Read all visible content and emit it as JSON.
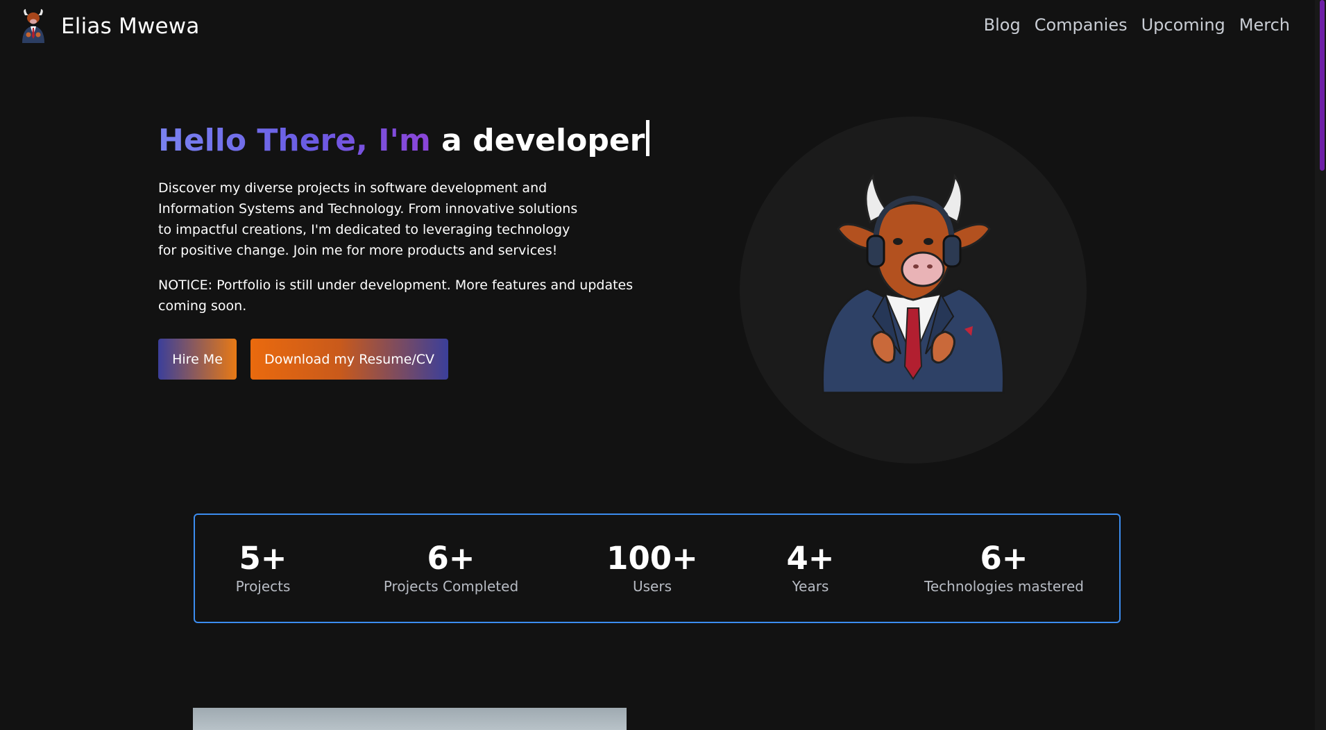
{
  "navbar": {
    "brand": "Elias Mwewa",
    "links": [
      "Blog",
      "Companies",
      "Upcoming",
      "Merch"
    ]
  },
  "hero": {
    "greeting": "Hello There, I'm",
    "typed": "a developer",
    "description": "Discover my diverse projects in software development and Information Systems and Technology. From innovative solutions to impactful creations, I'm dedicated to leveraging technology for positive change. Join me for more products and services!",
    "notice": "NOTICE: Portfolio is still under development. More features and updates coming soon.",
    "hire_label": "Hire Me",
    "resume_label": "Download my Resume/CV"
  },
  "stats": [
    {
      "value": "5+",
      "label": "Projects"
    },
    {
      "value": "6+",
      "label": "Projects Completed"
    },
    {
      "value": "100+",
      "label": "Users"
    },
    {
      "value": "4+",
      "label": "Years"
    },
    {
      "value": "6+",
      "label": "Technologies mastered"
    }
  ],
  "colors": {
    "background": "#121212",
    "heading_gradient_start": "#7a83f0",
    "heading_gradient_end": "#8b45d8",
    "orange": "#ea6a0e",
    "indigo": "#3b3f9a",
    "stats_border": "#3c8df0",
    "scrollbar_thumb": "#6d1fa6"
  },
  "icons": {
    "brand_logo": "bull-mascot-icon",
    "hero_image": "bull-in-suit-with-headphones"
  }
}
